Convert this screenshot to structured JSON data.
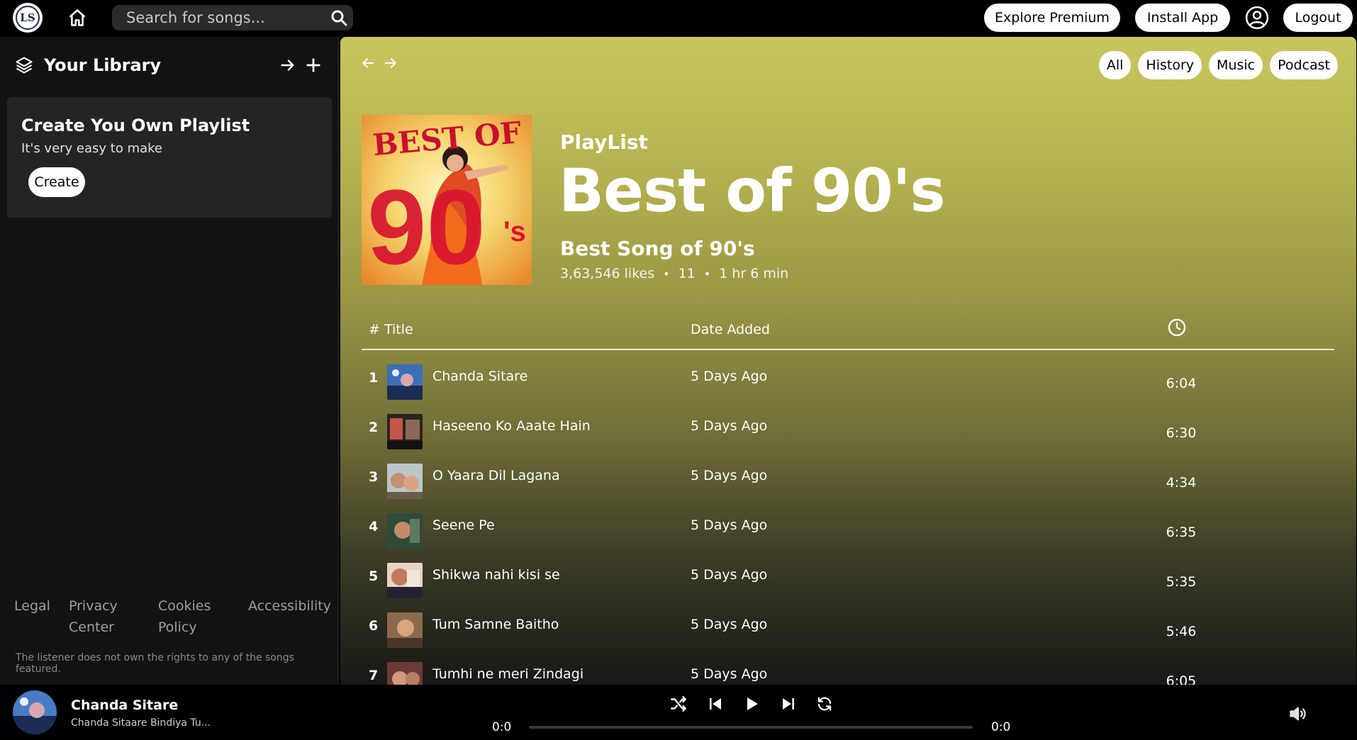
{
  "header": {
    "logo_text": "LS",
    "search_placeholder": "Search for songs...",
    "explore_premium": "Explore Premium",
    "install_app": "Install App",
    "logout": "Logout"
  },
  "sidebar": {
    "title": "Your Library",
    "create_card": {
      "title": "Create You Own Playlist",
      "subtitle": "It's very easy to make",
      "button": "Create"
    },
    "footer_links": [
      "Legal",
      "Privacy Center",
      "Cookies Policy",
      "Accessibility"
    ],
    "disclaimer": "The listener does not own the rights to any of the songs featured."
  },
  "main": {
    "filters": [
      "All",
      "History",
      "Music",
      "Podcast"
    ],
    "playlist": {
      "type": "PlayList",
      "title": "Best of 90's",
      "description": "Best Song of 90's",
      "likes": "3,63,546 likes",
      "count": "11",
      "duration": "1 hr 6 min",
      "cover_text_top": "BEST OF",
      "cover_text_big": "90",
      "cover_text_s": "'s"
    },
    "columns": {
      "title": "# Title",
      "date": "Date Added"
    },
    "songs": [
      {
        "num": "1",
        "title": "Chanda Sitare",
        "date": "5 Days Ago",
        "duration": "6:04"
      },
      {
        "num": "2",
        "title": "Haseeno Ko Aaate Hain",
        "date": "5 Days Ago",
        "duration": "6:30"
      },
      {
        "num": "3",
        "title": "O Yaara Dil Lagana",
        "date": "5 Days Ago",
        "duration": "4:34"
      },
      {
        "num": "4",
        "title": "Seene Pe",
        "date": "5 Days Ago",
        "duration": "6:35"
      },
      {
        "num": "5",
        "title": "Shikwa nahi kisi se",
        "date": "5 Days Ago",
        "duration": "5:35"
      },
      {
        "num": "6",
        "title": "Tum Samne Baitho",
        "date": "5 Days Ago",
        "duration": "5:46"
      },
      {
        "num": "7",
        "title": "Tumhi ne meri Zindagi",
        "date": "5 Days Ago",
        "duration": "6:05"
      }
    ]
  },
  "player": {
    "title": "Chanda Sitare",
    "subtitle": "Chanda Sitaare Bindiya Tu...",
    "current_time": "0:0",
    "total_time": "0:0",
    "progress": 0
  },
  "colors": {
    "accent_gradient_top": "#c9c65e",
    "background": "#000000",
    "sidebar": "#121212",
    "card": "#242424"
  }
}
